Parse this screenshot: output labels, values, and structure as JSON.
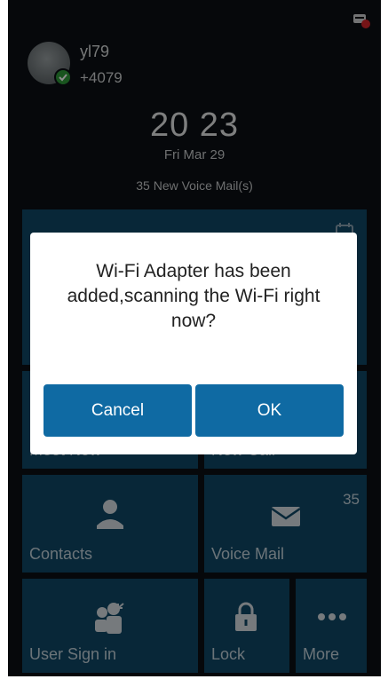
{
  "user": {
    "name": "yl79",
    "number": "+4079"
  },
  "clock": {
    "time": "20 23",
    "date": "Fri Mar 29"
  },
  "notice": {
    "voicemail": "35 New Voice Mail(s)"
  },
  "tiles": {
    "meet_now": "Meet Now",
    "new_call": "New Call",
    "contacts": "Contacts",
    "voice_mail": "Voice Mail",
    "voice_mail_count": "35",
    "user_sign_in": "User Sign in",
    "lock": "Lock",
    "more": "More"
  },
  "dialog": {
    "message": "Wi-Fi Adapter has been added,scanning the Wi-Fi right now?",
    "cancel_label": "Cancel",
    "ok_label": "OK"
  },
  "colors": {
    "tile_bg": "#0f4766",
    "dialog_button": "#0f6aa3",
    "presence_online": "#2e9a3a",
    "notification_red": "#d6262b"
  },
  "icons": {
    "status": "notification-badge-icon",
    "contacts": "person-icon",
    "voice_mail": "envelope-icon",
    "user_sign_in": "users-icon",
    "lock": "padlock-icon",
    "more": "ellipsis-icon",
    "calendar": "calendar-icon"
  }
}
